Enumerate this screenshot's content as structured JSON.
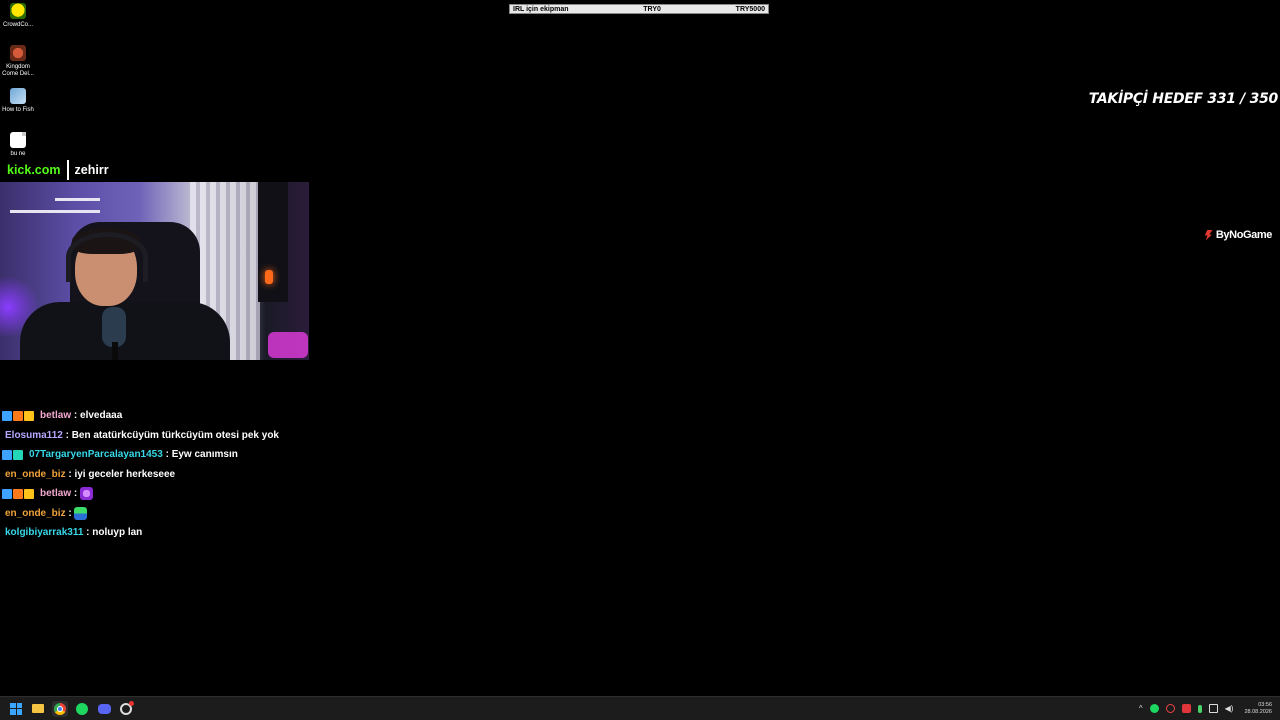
{
  "desktop_icons": [
    {
      "label": "CrowdCo...",
      "icon": "crowdcontrol-icon"
    },
    {
      "label": "Kingdom Come Del...",
      "icon": "kingdom-come-icon"
    },
    {
      "label": "How to Fish",
      "icon": "how-to-fish-icon"
    },
    {
      "label": "bu ne",
      "icon": "file-icon"
    }
  ],
  "donation_goal": {
    "label": "IRL için ekipman",
    "current": "TRY0",
    "target": "TRY5000",
    "progress": 0
  },
  "follower_goal": {
    "text": "TAKİPÇİ HEDEF 331 / 350"
  },
  "sponsor": {
    "text": "ByNoGame"
  },
  "kick": {
    "brand": "kick.com",
    "channel": "zehirr"
  },
  "chat": [
    {
      "badges": [
        "blue",
        "orange",
        "yellow"
      ],
      "user": "betlaw",
      "user_color": "#f3a8cf",
      "message": "elvedaaa",
      "emote": null
    },
    {
      "badges": [],
      "user": "Elosuma112",
      "user_color": "#b8a8ff",
      "message": "Ben atatürkcüyüm türkcüyüm otesi pek yok",
      "emote": null
    },
    {
      "badges": [
        "blue",
        "teal"
      ],
      "user": "07TargaryenParcalayan1453",
      "user_color": "#37d9e8",
      "message": "Eyw canımsın",
      "emote": null
    },
    {
      "badges": [],
      "user": "en_onde_biz",
      "user_color": "#f0a33a",
      "message": "iyi geceler herkeseee",
      "emote": null
    },
    {
      "badges": [
        "blue",
        "orange",
        "yellow"
      ],
      "user": "betlaw",
      "user_color": "#f3a8cf",
      "message": "",
      "emote": "purple"
    },
    {
      "badges": [],
      "user": "en_onde_biz",
      "user_color": "#f0a33a",
      "message": "",
      "emote": "green"
    },
    {
      "badges": [],
      "user": "kolgibiyarrak311",
      "user_color": "#37d9e8",
      "message": "noluyp lan",
      "emote": null
    }
  ],
  "taskbar": {
    "apps": [
      "start-icon",
      "file-explorer-icon",
      "chrome-icon",
      "spotify-icon",
      "discord-icon",
      "settings-app-icon"
    ],
    "time": "03:56",
    "date": "28.08.2026"
  }
}
